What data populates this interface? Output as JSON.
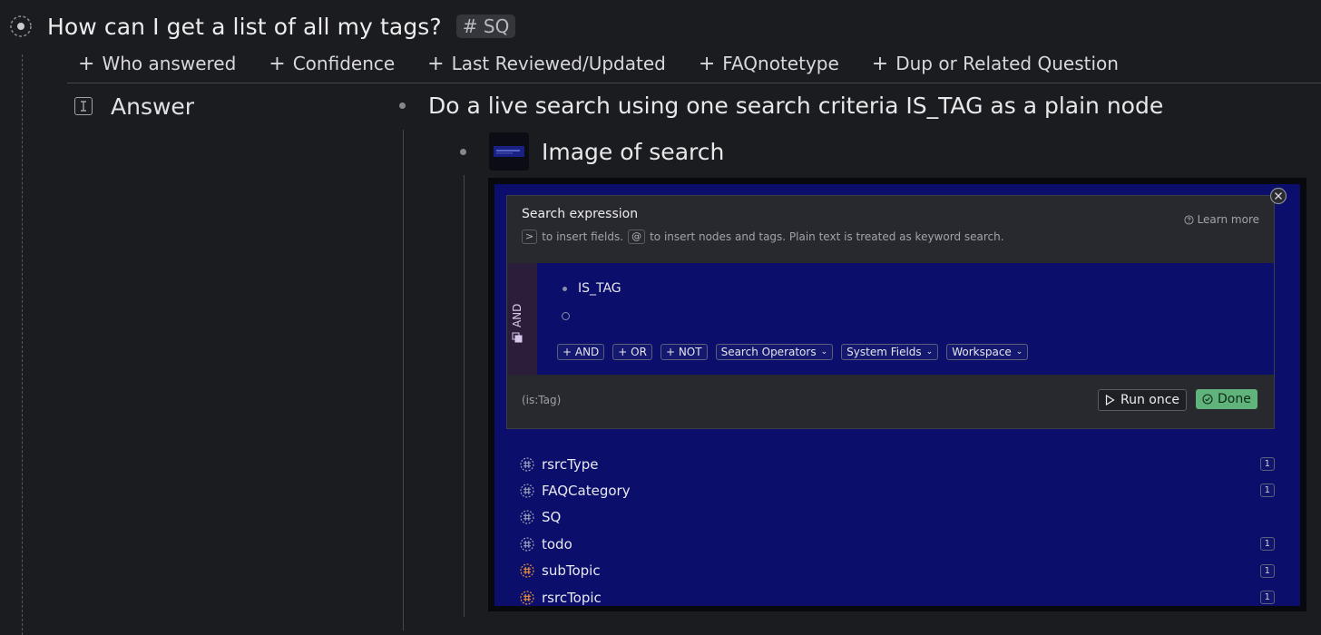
{
  "title": "How can I get a list of all my tags?",
  "title_tag": "# SQ",
  "fields": [
    {
      "label": "Who answered"
    },
    {
      "label": "Confidence"
    },
    {
      "label": "Last Reviewed/Updated"
    },
    {
      "label": "FAQnotetype"
    },
    {
      "label": "Dup or Related Question"
    }
  ],
  "answer": {
    "label": "Answer",
    "node1": "Do a live search using one search criteria IS_TAG as a plain node",
    "node2": "Image of search"
  },
  "search": {
    "title": "Search expression",
    "help_key1": ">",
    "help_text1": "to insert fields.",
    "help_key2": "@",
    "help_text2": "to insert nodes and tags. Plain text is treated as keyword search.",
    "learn_more": "Learn more",
    "operator": "AND",
    "query_item": "IS_TAG",
    "buttons": [
      {
        "label": "+ AND"
      },
      {
        "label": "+ OR"
      },
      {
        "label": "+ NOT"
      },
      {
        "label": "Search Operators"
      },
      {
        "label": "System Fields"
      },
      {
        "label": "Workspace"
      }
    ],
    "expression": "(is:Tag)",
    "run_once": "Run once",
    "done": "Done"
  },
  "results": [
    {
      "name": "rsrcType",
      "count": "1",
      "color": "#9aa0b8"
    },
    {
      "name": "FAQCategory",
      "count": "1",
      "color": "#9aa0b8"
    },
    {
      "name": "SQ",
      "count": "",
      "color": "#9aa0b8"
    },
    {
      "name": "todo",
      "count": "1",
      "color": "#9aa0b8"
    },
    {
      "name": "subTopic",
      "count": "1",
      "color": "#e8903a"
    },
    {
      "name": "rsrcTopic",
      "count": "1",
      "color": "#e8903a"
    }
  ]
}
